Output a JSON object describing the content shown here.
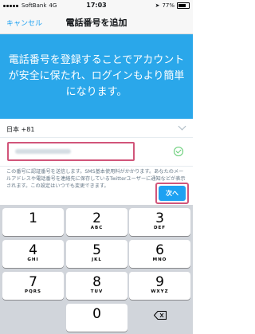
{
  "status": {
    "carrier": "SoftBank",
    "network": "4G",
    "time": "17:03",
    "battery": "77%"
  },
  "nav": {
    "cancel": "キャンセル",
    "title": "電話番号を追加"
  },
  "banner": {
    "text": "電話番号を登録することでアカウントが安全に保たれ、ログインもより簡単になります。"
  },
  "country": {
    "label": "日本 +81"
  },
  "note": {
    "text": "この番号に認証番号を送信します。SMS基本使用料がかかります。あなたのメールアドレスや電話番号を連絡先に保存しているTwitterユーザーに通知などが表示されます。この設定はいつでも変更できます。"
  },
  "next": {
    "label": "次へ"
  },
  "keys": [
    {
      "num": "1",
      "letters": ""
    },
    {
      "num": "2",
      "letters": "ABC"
    },
    {
      "num": "3",
      "letters": "DEF"
    },
    {
      "num": "4",
      "letters": "GHI"
    },
    {
      "num": "5",
      "letters": "JKL"
    },
    {
      "num": "6",
      "letters": "MNO"
    },
    {
      "num": "7",
      "letters": "PQRS"
    },
    {
      "num": "8",
      "letters": "TUV"
    },
    {
      "num": "9",
      "letters": "WXYZ"
    },
    {
      "num": "0",
      "letters": ""
    }
  ],
  "colors": {
    "accent": "#1da1f2",
    "banner": "#2aa7ea",
    "highlight": "#d1557a"
  },
  "battery_level": 0.77
}
